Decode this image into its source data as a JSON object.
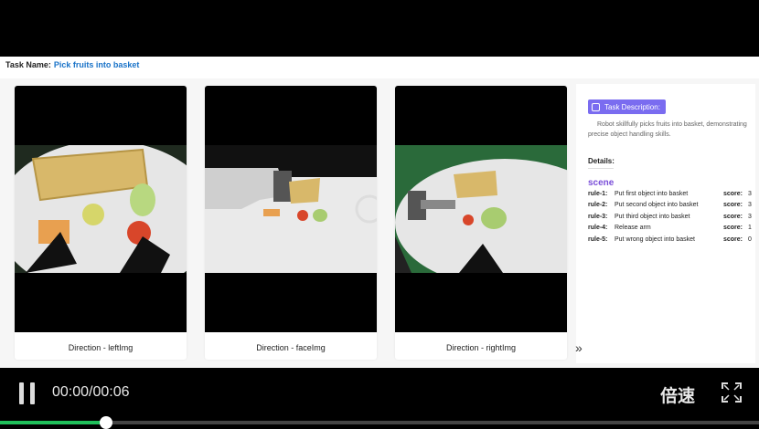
{
  "task": {
    "label": "Task Name:",
    "value": "Pick fruits into basket"
  },
  "cards": [
    {
      "label": "Direction - leftImg"
    },
    {
      "label": "Direction - faceImg"
    },
    {
      "label": "Direction - rightImg"
    }
  ],
  "side": {
    "desc_button": "Task Description:",
    "desc_text": "Robot skillfully picks fruits into basket, demonstrating precise object handling skills.",
    "details_title": "Details:",
    "scene_title": "scene",
    "score_label": "score:",
    "rules": [
      {
        "id": "rule-1:",
        "text": "Put first object into basket",
        "score": "3"
      },
      {
        "id": "rule-2:",
        "text": "Put second object into basket",
        "score": "3"
      },
      {
        "id": "rule-3:",
        "text": "Put third object into basket",
        "score": "3"
      },
      {
        "id": "rule-4:",
        "text": "Release arm",
        "score": "1"
      },
      {
        "id": "rule-5:",
        "text": "Put wrong object into basket",
        "score": "0"
      }
    ]
  },
  "nav": {
    "next_glyph": "»"
  },
  "player": {
    "time": "00:00/00:06",
    "speed_label": "倍速",
    "progress": 0.14,
    "icons": [
      "pause-icon",
      "fullscreen-icon"
    ],
    "colors": {
      "progress": "#1fbf5a",
      "accent": "#7a6cf0"
    }
  }
}
